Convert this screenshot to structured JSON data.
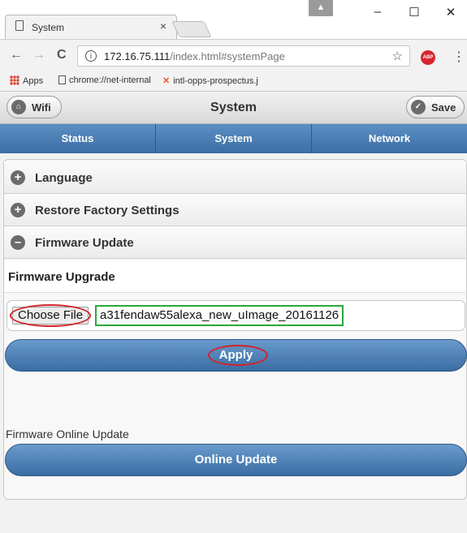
{
  "browser": {
    "tab_title": "System",
    "tab_close": "×",
    "window_user": "▲",
    "window_minimize": "–",
    "window_maximize": "☐",
    "window_close": "✕",
    "nav_back": "←",
    "nav_forward": "→",
    "nav_reload": "C",
    "url_host": "172.16.75.111",
    "url_path": "/index.html#systemPage",
    "info_icon": "i",
    "bookmark_star": "☆",
    "abp_label": "ABP",
    "menu": "⋮",
    "bookmarks": [
      {
        "label": "Apps"
      },
      {
        "label": "chrome://net-internal"
      },
      {
        "label": "intl-opps-prospectus.j"
      }
    ]
  },
  "app": {
    "title": "System",
    "wifi_button": "Wifi",
    "save_button": "Save",
    "nav": [
      {
        "label": "Status"
      },
      {
        "label": "System"
      },
      {
        "label": "Network"
      }
    ],
    "sections": [
      {
        "label": "Language",
        "icon": "+"
      },
      {
        "label": "Restore Factory Settings",
        "icon": "+"
      },
      {
        "label": "Firmware Update",
        "icon": "–"
      }
    ],
    "firmware": {
      "upgrade_title": "Firmware Upgrade",
      "choose_file_label": "Choose File",
      "file_name": "a31fendaw55alexa_new_uImage_20161126",
      "apply_button": "Apply",
      "online_label": "Firmware Online Update",
      "online_button": "Online Update"
    }
  },
  "colors": {
    "nav_blue": "#3b6ea5",
    "annotation_red": "#d1232a",
    "annotation_green": "#27a83a"
  }
}
